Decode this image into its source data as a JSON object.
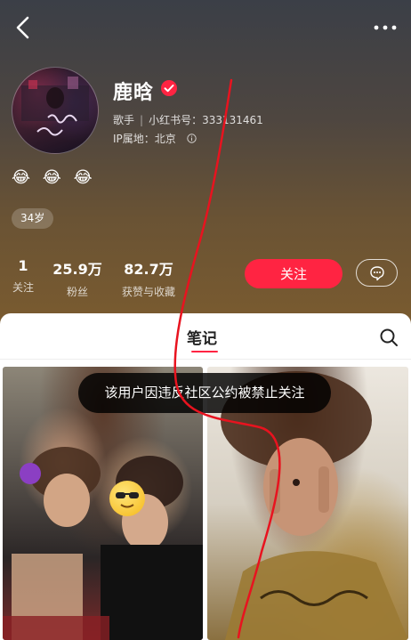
{
  "header": {
    "back_icon": "chevron-left-icon",
    "more_icon": "ellipsis-icon"
  },
  "profile": {
    "nickname": "鹿晗",
    "verified_icon": "verified-check-icon",
    "occupation": "歌手",
    "id_label": "小红书号：",
    "id_value": "333131461",
    "ip_label": "IP属地：",
    "ip_value": "北京",
    "ip_info_icon": "info-icon",
    "bio_emojis": [
      "😂",
      "😂",
      "😂"
    ],
    "age_tag": "34岁"
  },
  "stats": [
    {
      "value": "1",
      "label": "关注"
    },
    {
      "value": "25.9万",
      "label": "粉丝"
    },
    {
      "value": "82.7万",
      "label": "获赞与收藏"
    }
  ],
  "actions": {
    "follow_label": "关注",
    "chat_icon": "chat-bubble-icon"
  },
  "tabs": {
    "active_label": "笔记",
    "search_icon": "search-icon"
  },
  "toast": {
    "message": "该用户因违反社区公约被禁止关注"
  },
  "colors": {
    "accent": "#ff2442",
    "annotation_line": "#e8131f"
  }
}
